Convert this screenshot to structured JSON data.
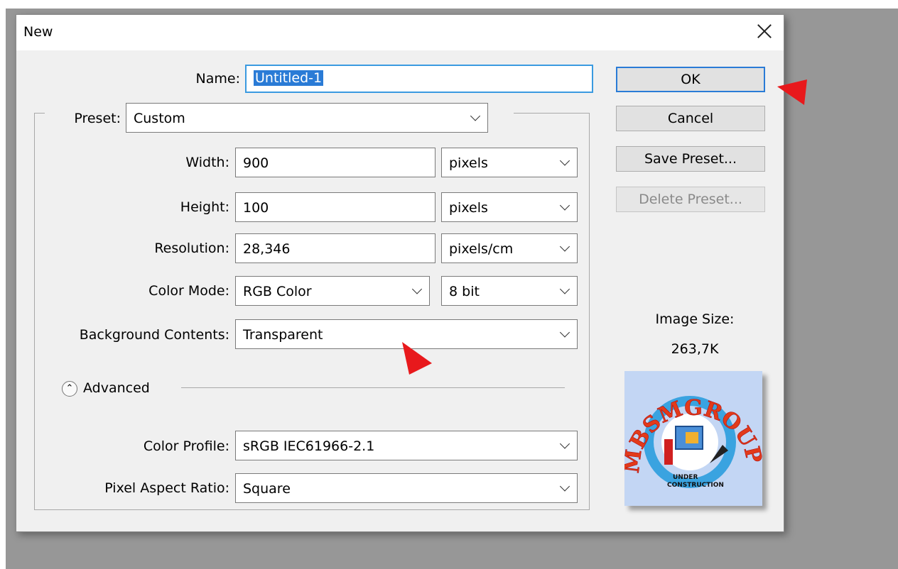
{
  "dialog": {
    "title": "New"
  },
  "form": {
    "name": {
      "label": "Name:",
      "value": "Untitled-1"
    },
    "preset": {
      "label": "Preset:",
      "value": "Custom"
    },
    "width": {
      "label": "Width:",
      "value": "900",
      "unit": "pixels"
    },
    "height": {
      "label": "Height:",
      "value": "100",
      "unit": "pixels"
    },
    "resolution": {
      "label": "Resolution:",
      "value": "28,346",
      "unit": "pixels/cm"
    },
    "color_mode": {
      "label": "Color Mode:",
      "value": "RGB Color",
      "depth": "8 bit"
    },
    "background": {
      "label": "Background Contents:",
      "value": "Transparent"
    },
    "advanced": {
      "label": "Advanced"
    },
    "color_profile": {
      "label": "Color Profile:",
      "value": "sRGB IEC61966-2.1"
    },
    "pixel_aspect": {
      "label": "Pixel Aspect Ratio:",
      "value": "Square"
    }
  },
  "buttons": {
    "ok": "OK",
    "cancel": "Cancel",
    "save_preset": "Save Preset...",
    "delete_preset": "Delete Preset..."
  },
  "image_size": {
    "label": "Image Size:",
    "value": "263,7K"
  },
  "logo": {
    "text_main": "MBSMGROUP",
    "text_sub1": "UNDER",
    "text_sub2": "CONSTRUCTION"
  },
  "colors": {
    "accent": "#2a7bd6",
    "annotation_arrow": "#e8191c"
  },
  "icons": [
    "close-icon",
    "chevron-down-icon",
    "double-chevron-up-icon",
    "arrow-annotation-icon"
  ]
}
